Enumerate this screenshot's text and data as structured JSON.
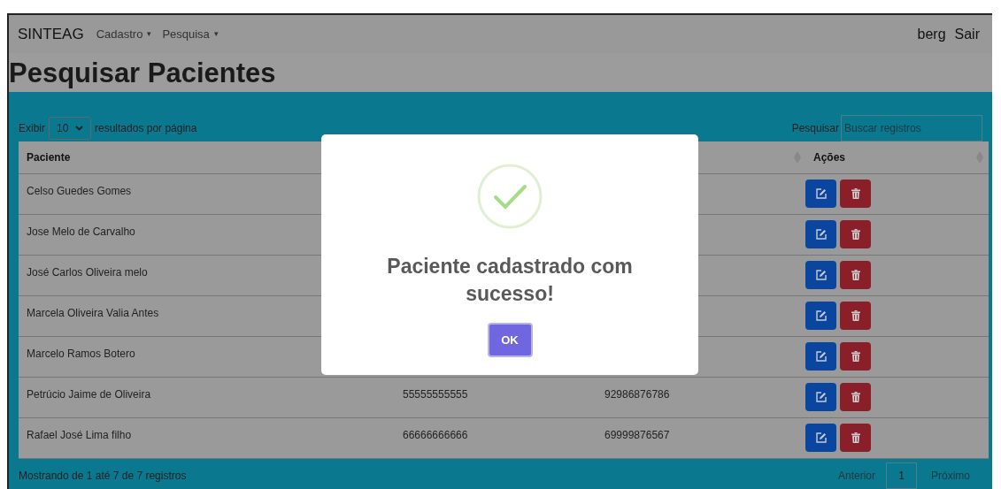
{
  "navbar": {
    "brand": "SINTEAG",
    "menus": [
      {
        "label": "Cadastro",
        "caret": "▾"
      },
      {
        "label": "Pesquisa",
        "caret": "▾"
      }
    ],
    "user": "berg",
    "logout": "Sair"
  },
  "page_title": "Pesquisar Pacientes",
  "length_control": {
    "prefix": "Exibir",
    "value": "10",
    "suffix": "resultados por página"
  },
  "search": {
    "label": "Pesquisar",
    "placeholder": "Buscar registros"
  },
  "table": {
    "columns": [
      "Paciente",
      "Ações"
    ],
    "rows": [
      {
        "paciente": "Celso Guedes Gomes"
      },
      {
        "paciente": "Jose Melo de Carvalho"
      },
      {
        "paciente": "José Carlos Oliveira melo"
      },
      {
        "paciente": "Marcela Oliveira Valia Antes"
      },
      {
        "paciente": "Marcelo Ramos Botero"
      },
      {
        "paciente": "Petrúcio Jaime de Oliveira",
        "column_2": "55555555555",
        "column_3": "92986876786"
      },
      {
        "paciente": "Rafael José Lima filho",
        "column_2": "66666666666",
        "column_3": "69999876567"
      }
    ]
  },
  "info": "Mostrando de 1 até 7 de 7 registros",
  "pagination": {
    "previous": "Anterior",
    "pages": [
      {
        "label": "1",
        "selected": true
      }
    ],
    "next": "Próximo"
  },
  "dialog": {
    "message": "Paciente cadastrado com sucesso!",
    "button": "OK"
  }
}
